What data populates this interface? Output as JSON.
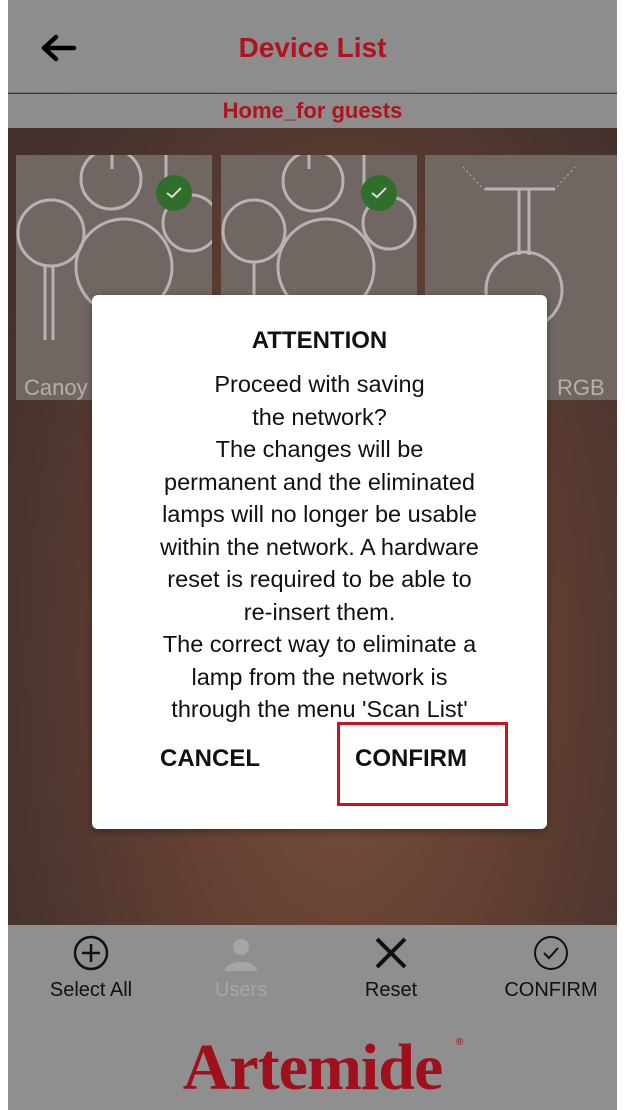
{
  "header": {
    "title": "Device List",
    "back_icon": "arrow-left-icon"
  },
  "subheader": {
    "group": "Home_for guests"
  },
  "devices": [
    {
      "label": "Canoy",
      "selected": true
    },
    {
      "label": "",
      "selected": true
    },
    {
      "label": "RGB",
      "selected": false
    }
  ],
  "dialog": {
    "title": "ATTENTION",
    "lines": [
      "Proceed with saving",
      "the network?",
      "The changes will be",
      "permanent and the eliminated",
      "lamps will no longer be usable",
      "within the network. A hardware",
      "reset is required to be able to",
      "re-insert them.",
      "The correct way to eliminate a",
      "lamp from the network is",
      "through the menu 'Scan List'"
    ],
    "cancel_label": "CANCEL",
    "confirm_label": "CONFIRM"
  },
  "toolbar": {
    "select_all": "Select All",
    "users": "Users",
    "reset": "Reset",
    "confirm": "CONFIRM"
  },
  "brand": "Artemide",
  "colors": {
    "accent": "#b0121f",
    "header_bg": "#8d8d8d",
    "check": "#2c7d2c"
  }
}
